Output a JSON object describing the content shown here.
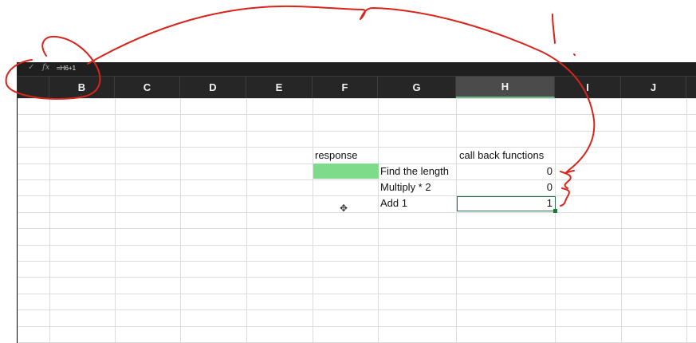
{
  "formula_bar": {
    "check_icon": "check-icon",
    "fx_label": "fx",
    "formula": "=H6+1"
  },
  "columns": [
    "B",
    "C",
    "D",
    "E",
    "F",
    "G",
    "H",
    "I",
    "J"
  ],
  "selected_column": "H",
  "cells": {
    "F4": "response",
    "H4": "call back functions",
    "G5": "Find the length",
    "H5": "0",
    "G6": "Multiply * 2",
    "H6": "0",
    "G7": "Add 1",
    "H7": "1"
  },
  "colors": {
    "header_bg": "#262626",
    "formula_bar_bg": "#1f1f1f",
    "highlight_fill": "#7ddc8a",
    "selection_border": "#217346",
    "annotation_ink": "#d9241c"
  }
}
